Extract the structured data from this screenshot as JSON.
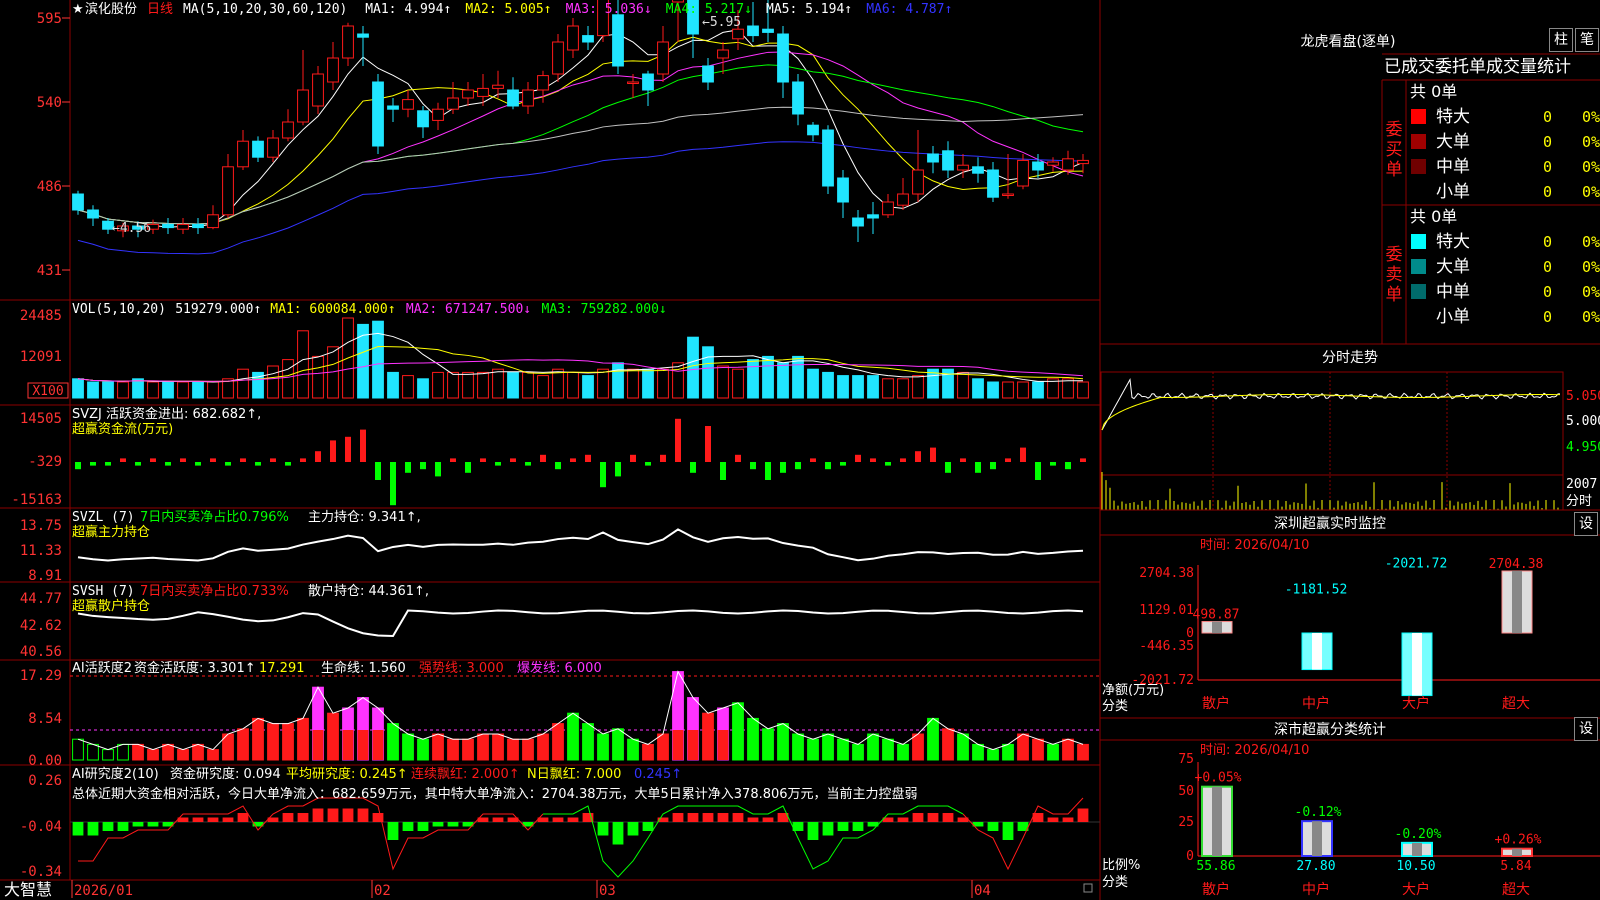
{
  "colors": {
    "up": "#ff1a1a",
    "down": "#20e5ff",
    "ma1": "#ffffff",
    "ma2": "#ffff00",
    "ma3": "#ff33ff",
    "ma4": "#00ff00",
    "ma5": "#c0c0c0",
    "ma6": "#3333ff",
    "grid": "#8b0000",
    "axis": "#ff3333"
  },
  "kline": {
    "header": {
      "star": "★",
      "name": "滨化股份",
      "period": "日线",
      "ma_def": "MA(5,10,20,30,60,120)",
      "ma1": "MA1: 4.994↑",
      "ma2": "MA2: 5.005↑",
      "ma3": "MA3: 5.036↓",
      "ma4": "MA4: 5.217↓",
      "ma5": "MA5: 5.194↑",
      "ma6": "MA6: 4.787↑"
    },
    "y_ticks": [
      "595",
      "540",
      "486",
      "431"
    ],
    "hi_label": "5.95",
    "lo_label": "4.56",
    "ylim": [
      4.25,
      6.0
    ],
    "candles": [
      [
        4.85,
        4.75,
        4.87,
        4.72
      ],
      [
        4.75,
        4.7,
        4.78,
        4.65
      ],
      [
        4.68,
        4.63,
        4.7,
        4.6
      ],
      [
        4.62,
        4.65,
        4.67,
        4.58
      ],
      [
        4.65,
        4.63,
        4.68,
        4.58
      ],
      [
        4.63,
        4.66,
        4.69,
        4.6
      ],
      [
        4.66,
        4.64,
        4.7,
        4.6
      ],
      [
        4.63,
        4.66,
        4.7,
        4.6
      ],
      [
        4.66,
        4.64,
        4.7,
        4.6
      ],
      [
        4.64,
        4.72,
        4.78,
        4.63
      ],
      [
        4.72,
        5.02,
        5.1,
        4.7
      ],
      [
        5.02,
        5.18,
        5.25,
        5.0
      ],
      [
        5.18,
        5.08,
        5.21,
        5.05
      ],
      [
        5.08,
        5.2,
        5.25,
        5.05
      ],
      [
        5.2,
        5.3,
        5.38,
        5.18
      ],
      [
        5.3,
        5.5,
        5.75,
        5.28
      ],
      [
        5.4,
        5.6,
        5.65,
        5.35
      ],
      [
        5.55,
        5.7,
        5.8,
        5.5
      ],
      [
        5.7,
        5.9,
        5.92,
        5.65
      ],
      [
        5.85,
        5.83,
        5.9,
        5.65
      ],
      [
        5.55,
        5.15,
        5.6,
        5.1
      ],
      [
        5.4,
        5.38,
        5.45,
        5.3
      ],
      [
        5.38,
        5.44,
        5.5,
        5.33
      ],
      [
        5.37,
        5.27,
        5.4,
        5.2
      ],
      [
        5.31,
        5.38,
        5.42,
        5.25
      ],
      [
        5.38,
        5.45,
        5.55,
        5.35
      ],
      [
        5.45,
        5.5,
        5.55,
        5.4
      ],
      [
        5.46,
        5.51,
        5.6,
        5.4
      ],
      [
        5.51,
        5.53,
        5.62,
        5.45
      ],
      [
        5.5,
        5.4,
        5.58,
        5.38
      ],
      [
        5.4,
        5.5,
        5.55,
        5.35
      ],
      [
        5.5,
        5.59,
        5.62,
        5.42
      ],
      [
        5.6,
        5.8,
        5.85,
        5.55
      ],
      [
        5.75,
        5.9,
        5.95,
        5.7
      ],
      [
        5.84,
        5.8,
        5.9,
        5.75
      ],
      [
        5.84,
        6.1,
        6.2,
        5.8
      ],
      [
        5.97,
        5.65,
        6.15,
        5.6
      ],
      [
        5.55,
        5.55,
        5.6,
        5.45
      ],
      [
        5.6,
        5.5,
        5.62,
        5.4
      ],
      [
        5.6,
        5.8,
        5.9,
        5.55
      ],
      [
        6.05,
        6.35,
        6.4,
        5.8
      ],
      [
        6.33,
        5.85,
        6.35,
        5.7
      ],
      [
        5.65,
        5.55,
        5.7,
        5.5
      ],
      [
        5.7,
        5.75,
        5.8,
        5.6
      ],
      [
        5.82,
        5.88,
        6.0,
        5.75
      ],
      [
        5.9,
        5.84,
        6.05,
        5.8
      ],
      [
        5.88,
        5.86,
        6.1,
        5.8
      ],
      [
        5.85,
        5.55,
        5.9,
        5.45
      ],
      [
        5.55,
        5.35,
        5.6,
        5.28
      ],
      [
        5.28,
        5.22,
        5.3,
        5.18
      ],
      [
        5.25,
        4.9,
        5.28,
        4.85
      ],
      [
        4.95,
        4.8,
        5.0,
        4.7
      ],
      [
        4.7,
        4.65,
        4.75,
        4.55
      ],
      [
        4.72,
        4.7,
        4.8,
        4.6
      ],
      [
        4.72,
        4.8,
        4.85,
        4.7
      ],
      [
        4.78,
        4.85,
        4.95,
        4.75
      ],
      [
        4.85,
        5.0,
        5.25,
        4.8
      ],
      [
        5.1,
        5.05,
        5.15,
        4.98
      ],
      [
        5.12,
        5.0,
        5.18,
        4.95
      ],
      [
        5.0,
        5.03,
        5.1,
        4.95
      ],
      [
        5.02,
        4.98,
        5.08,
        4.92
      ],
      [
        5.0,
        4.83,
        5.05,
        4.8
      ],
      [
        4.85,
        4.85,
        5.1,
        4.82
      ],
      [
        4.9,
        5.06,
        5.1,
        4.88
      ],
      [
        5.05,
        5.0,
        5.1,
        4.95
      ],
      [
        5.03,
        5.05,
        5.08,
        4.99
      ],
      [
        5.0,
        5.07,
        5.12,
        4.97
      ],
      [
        5.04,
        5.06,
        5.1,
        4.98
      ]
    ]
  },
  "vol": {
    "header": {
      "def": "VOL(5,10,20)",
      "val": "519279.000↑",
      "ma1": "MA1: 600084.000↑",
      "ma2": "MA2: 671247.500↓",
      "ma3": "MA3: 759282.000↓"
    },
    "y_ticks": [
      "24485",
      "12091"
    ],
    "unit": "X100",
    "bars": [
      6,
      5,
      5,
      5,
      6,
      5,
      5,
      5,
      5,
      5,
      6,
      9,
      8,
      10,
      12,
      21,
      13,
      16,
      25,
      23,
      24,
      8,
      7,
      6,
      8,
      8,
      8,
      8,
      9,
      8,
      8,
      7,
      9,
      8,
      7,
      9,
      11,
      9,
      9,
      9,
      11,
      19,
      16,
      10,
      9,
      12,
      13,
      11,
      13,
      9,
      8,
      7,
      7,
      7,
      6,
      6,
      7,
      9,
      9,
      8,
      6,
      5,
      5,
      5,
      5,
      6,
      6,
      5
    ]
  },
  "svzj": {
    "header": {
      "def": "SVZJ",
      "label": "活跃资金进出: 682.682↑,",
      "sub": "超赢资金流(万元)"
    },
    "y_ticks": [
      "14505",
      "-329",
      "-15163"
    ],
    "vals": [
      -2,
      -1,
      -1,
      1,
      -1,
      1,
      -1,
      1,
      -1,
      1,
      -1,
      1,
      -1,
      1,
      -1,
      1,
      3,
      6,
      7,
      9,
      -5,
      -12,
      -3,
      -2,
      -4,
      1,
      -3,
      1,
      -1,
      1,
      -1,
      2,
      -2,
      1,
      2,
      -7,
      -4,
      2,
      -1,
      2,
      12,
      -3,
      10,
      -5,
      2,
      -2,
      -5,
      -3,
      -2,
      1,
      -2,
      -1,
      2,
      1,
      -1,
      1,
      3,
      4,
      -3,
      1,
      -3,
      -2,
      1,
      4,
      -5,
      -1,
      -2,
      1
    ]
  },
  "svzl": {
    "header": {
      "def": "SVZL (7)",
      "label1": "7日内买卖净占比0.796%",
      "label2": "主力持仓: 9.341↑,",
      "sub": "超赢主力持仓"
    },
    "y_ticks": [
      "13.75",
      "11.33",
      "8.91"
    ]
  },
  "svsh": {
    "header": {
      "def": "SVSH (7)",
      "label1": "7日内买卖净占比0.733%",
      "label2": "散户持仓: 44.361↑,",
      "sub": "超赢散户持仓"
    },
    "y_ticks": [
      "44.77",
      "42.62",
      "40.56"
    ]
  },
  "ai1": {
    "header": {
      "def": "AI活跃度2",
      "a": "资金活跃度: 3.301↑",
      "b": "17.291",
      "c": "生命线: 1.560",
      "d": "强势线: 3.000",
      "e": "爆发线: 6.000"
    },
    "y_ticks": [
      "17.29",
      "8.54",
      "0.00"
    ],
    "vals": [
      4,
      3,
      2,
      3,
      3,
      2,
      3,
      2,
      3,
      2,
      5,
      6,
      8,
      7,
      7,
      8,
      14,
      9,
      10,
      12,
      10,
      7,
      5,
      4,
      5,
      4,
      4,
      5,
      5,
      4,
      4,
      5,
      7,
      9,
      7,
      5,
      6,
      4,
      3,
      5,
      17,
      12,
      9,
      10,
      11,
      8,
      6,
      7,
      5,
      4,
      5,
      4,
      3,
      5,
      4,
      3,
      5,
      8,
      6,
      5,
      3,
      2,
      3,
      5,
      4,
      3,
      4,
      3
    ],
    "green_idx": [
      0,
      1,
      2,
      3,
      21,
      22,
      23,
      33,
      34,
      35,
      36,
      37,
      44,
      45,
      46,
      47,
      48,
      49,
      50,
      51,
      52,
      53,
      54,
      55,
      57,
      59,
      60,
      61,
      62,
      65
    ]
  },
  "ai2": {
    "header": {
      "def": "AI研究度2(10)",
      "a": "资金研究度: 0.094",
      "b": "平均研究度: 0.245↑",
      "c": "连续飘红: 2.000↑",
      "d": "N日飘红: 7.000",
      "e": "0.245↑"
    },
    "summary": "总体近期大资金相对活跃，今日大单净流入：682.659万元，其中特大单净流入：2704.38万元，大单5日累计净入378.806万元，当前主力控盘弱",
    "y_ticks": [
      "0.26",
      "-0.04",
      "-0.34"
    ],
    "vals": [
      -3,
      -3,
      -2,
      -2,
      -1,
      -1,
      -1,
      1,
      1,
      1,
      1,
      2,
      -1,
      1,
      2,
      2,
      3,
      3,
      3,
      3,
      2,
      -4,
      -2,
      -2,
      -1,
      -1,
      -1,
      1,
      1,
      1,
      -1,
      1,
      1,
      1,
      2,
      -3,
      -5,
      -3,
      -2,
      1,
      2,
      2,
      2,
      2,
      2,
      1,
      1,
      2,
      -2,
      -4,
      -3,
      -2,
      -2,
      -1,
      1,
      1,
      2,
      2,
      2,
      1,
      -1,
      -2,
      -4,
      -2,
      2,
      1,
      1,
      3
    ]
  },
  "xaxis": {
    "labels": [
      {
        "text": "2026/01",
        "i": 0
      },
      {
        "text": "02",
        "i": 20
      },
      {
        "text": "03",
        "i": 35
      },
      {
        "text": "04",
        "i": 60
      }
    ]
  },
  "brand": "大智慧",
  "lhb": {
    "title": "龙虎看盘(逐单)",
    "btn1": "柱",
    "btn2": "笔",
    "subtitle": "已成交委托单成交量统计",
    "buy": {
      "side": "委买单",
      "total": "共 0单",
      "rows": [
        {
          "label": "特大",
          "n": "0",
          "pct": "0%",
          "color": "#ff0000"
        },
        {
          "label": "大单",
          "n": "0",
          "pct": "0%",
          "color": "#a00000"
        },
        {
          "label": "中单",
          "n": "0",
          "pct": "0%",
          "color": "#700000"
        },
        {
          "label": "小单",
          "n": "0",
          "pct": "0%",
          "color": ""
        }
      ]
    },
    "sell": {
      "side": "委卖单",
      "total": "共 0单",
      "rows": [
        {
          "label": "特大",
          "n": "0",
          "pct": "0%",
          "color": "#00ffff"
        },
        {
          "label": "大单",
          "n": "0",
          "pct": "0%",
          "color": "#008b8b"
        },
        {
          "label": "中单",
          "n": "0",
          "pct": "0%",
          "color": "#006b6b"
        },
        {
          "label": "小单",
          "n": "0",
          "pct": "0%",
          "color": ""
        }
      ]
    }
  },
  "intraday": {
    "title": "分时走势",
    "y_ticks": [
      "5.050",
      "5.000",
      "4.950"
    ],
    "vol_label": "2007",
    "vol_unit": "分时"
  },
  "monitor": {
    "title": "深圳超赢实时监控",
    "settings": "设",
    "time": "时间: 2026/04/10",
    "y_ticks": [
      "2704.38",
      "1129.01",
      "0",
      "-446.35",
      "-2021.72"
    ],
    "ylabel1": "净额(万元)",
    "ylabel2": "分类",
    "cats": [
      "散户",
      "中户",
      "大户",
      "超大"
    ],
    "values": [
      498.87,
      -1181.52,
      -2021.72,
      2704.38
    ],
    "labels": [
      "498.87",
      "-1181.52",
      "-2021.72",
      "2704.38"
    ]
  },
  "classify": {
    "title": "深市超赢分类统计",
    "settings": "设",
    "time": "时间: 2026/04/10",
    "y_ticks": [
      "75",
      "50",
      "25",
      "0"
    ],
    "ylabel1": "比例%",
    "ylabel2": "分类",
    "cats": [
      "散户",
      "中户",
      "大户",
      "超大"
    ],
    "values": [
      55.86,
      27.8,
      10.5,
      5.84
    ],
    "value_labels": [
      "55.86",
      "27.80",
      "10.50",
      "5.84"
    ],
    "chg_labels": [
      "+0.05%",
      "-0.12%",
      "-0.20%",
      "+0.26%"
    ]
  }
}
